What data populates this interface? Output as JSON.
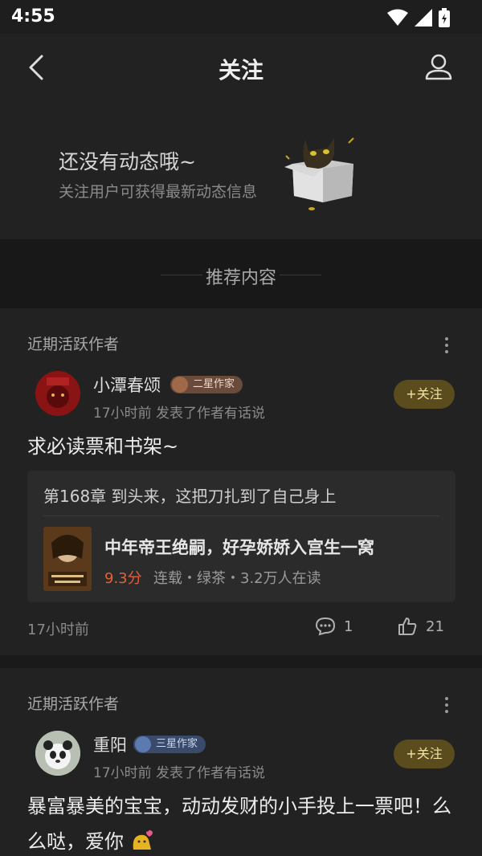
{
  "status_bar": {
    "time": "4:55"
  },
  "nav": {
    "title": "关注"
  },
  "empty_state": {
    "headline": "还没有动态哦~",
    "subtext": "关注用户可获得最新动态信息"
  },
  "recommend": {
    "label": "推荐内容"
  },
  "posts": [
    {
      "section_label": "近期活跃作者",
      "author": "小潭春颂",
      "badge": "二星作家",
      "meta": "17小时前 发表了作者有话说",
      "follow_label": "+关注",
      "text": "求必读票和书架~",
      "chapter": "第168章  到头来，这把刀扎到了自己身上",
      "book_title": "中年帝王绝嗣，好孕娇娇入宫生一窝",
      "score": "9.3分",
      "book_meta": "连载・绿茶・3.2万人在读",
      "time": "17小时前",
      "comments": "1",
      "likes": "21"
    },
    {
      "section_label": "近期活跃作者",
      "author": "重阳",
      "badge": "三星作家",
      "meta": "17小时前 发表了作者有话说",
      "follow_label": "+关注",
      "text": "暴富暴美的宝宝，动动发财的小手投上一票吧！么么哒，爱你"
    }
  ],
  "colors": {
    "background": "#222222",
    "follow_button": "#5b4c1e",
    "follow_text": "#f3e2a6",
    "score": "#e0623a",
    "badge_two_star": "#6a4a3a",
    "badge_three_star": "#3a4a6a"
  }
}
